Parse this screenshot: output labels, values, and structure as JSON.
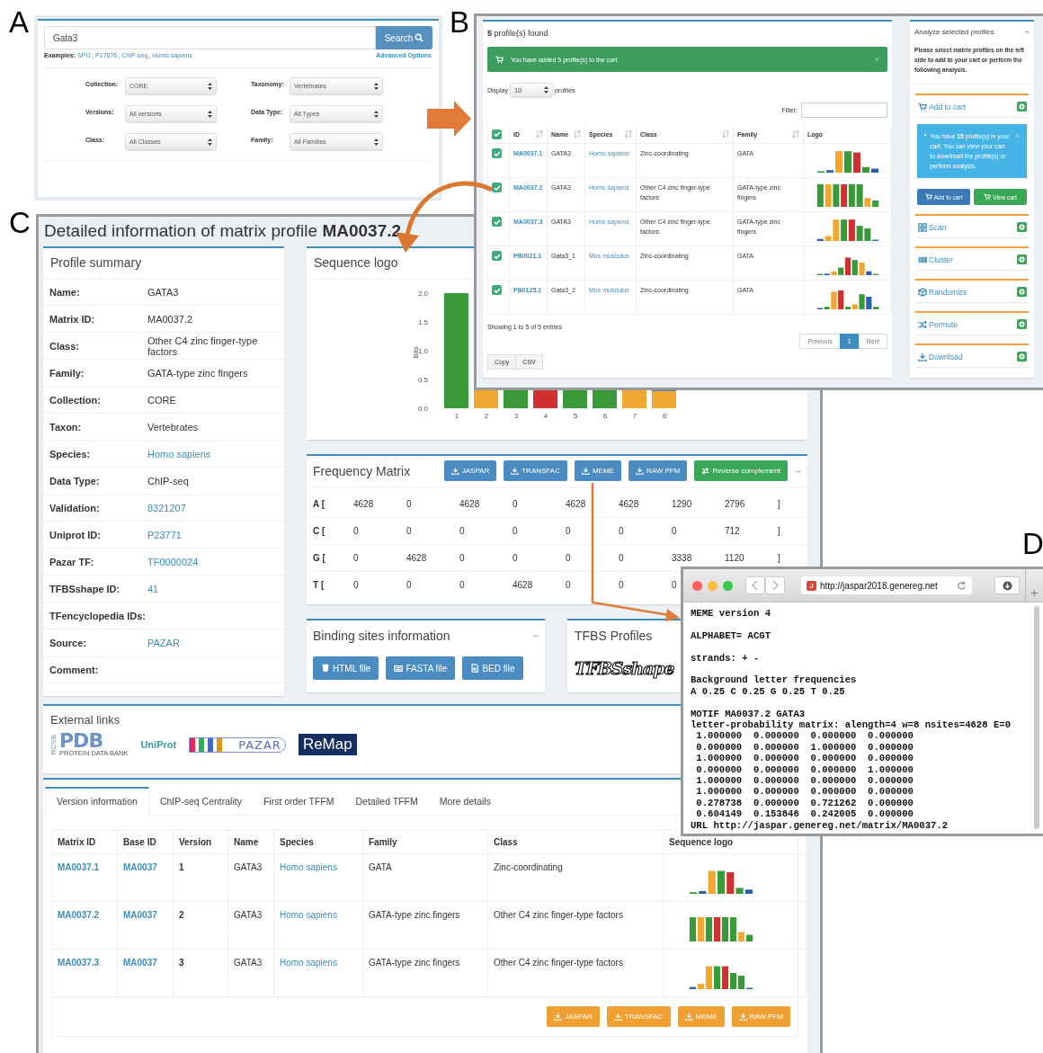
{
  "figure_labels": [
    "A",
    "B",
    "C",
    "D"
  ],
  "panel_a": {
    "search": {
      "value": "Gata3",
      "button": "Search"
    },
    "examples_label": "Examples:",
    "examples": [
      {
        "text": "SPI1",
        "sep": ","
      },
      {
        "text": "P17676",
        "sep": ","
      },
      {
        "text": "ChIP-seq",
        "sep": ","
      },
      {
        "text": "Homo sapiens"
      }
    ],
    "advanced": "Advanced Options",
    "filters": [
      {
        "label": "Collection:",
        "value": "CORE"
      },
      {
        "label": "Taxonomy:",
        "value": "Vertebrates"
      },
      {
        "label": "Versions:",
        "value": "All versions"
      },
      {
        "label": "Data Type:",
        "value": "All Types"
      },
      {
        "label": "Class:",
        "value": "All Classes"
      },
      {
        "label": "Family:",
        "value": "All Families"
      }
    ]
  },
  "panel_b": {
    "results": {
      "title": "**5** profile(s) found",
      "alert": "You have added 5 profile(s) to the cart.",
      "alert_close": "×",
      "display_label": "Display",
      "display_value": "10",
      "display_suffix": "profiles",
      "filter_label": "Filter:",
      "all_checked": true,
      "columns": [
        "ID",
        "Name",
        "Species",
        "Class",
        "Family",
        "Logo"
      ],
      "rows": [
        {
          "checked": true,
          "id": "MA0037.1",
          "name": "GATA3",
          "species": "Homo sapiens",
          "class": "Zinc-coordinating",
          "family": "GATA"
        },
        {
          "checked": true,
          "id": "MA0037.2",
          "name": "GATA3",
          "species": "Homo sapiens",
          "class": "Other C4 zinc finger-type factors",
          "family": "GATA-type zinc fingers"
        },
        {
          "checked": true,
          "id": "MA0037.3",
          "name": "GATA3",
          "species": "Homo sapiens",
          "class": "Other C4 zinc finger-type factors",
          "family": "GATA-type zinc fingers"
        },
        {
          "checked": true,
          "id": "PB0021.1",
          "name": "Gata3_1",
          "species": "Mus musculus",
          "class": "Zinc-coordinating",
          "family": "GATA"
        },
        {
          "checked": true,
          "id": "PB0125.1",
          "name": "Gata3_2",
          "species": "Mus musculus",
          "class": "Zinc-coordinating",
          "family": "GATA"
        }
      ],
      "info": "Showing 1 to 5 of 5 entries",
      "pages": [
        {
          "label": "Previous",
          "selected": false
        },
        {
          "label": "1",
          "selected": true
        },
        {
          "label": "Next",
          "selected": false
        }
      ],
      "export_buttons": [
        "Copy",
        "CSV"
      ]
    },
    "analyze": {
      "title": "Analyze selected profiles",
      "collapse": "−",
      "note": "Please select matrix profiles on the left side to add to your cart or perform the following analysis.",
      "cart_info": "You have **15** profile(s) in your cart. You can view your cart to download the profile(s) or perform analysis.",
      "info_close": "×",
      "cart_buttons": [
        {
          "label": "Add to cart",
          "kind": "primary"
        },
        {
          "label": "View cart",
          "kind": "success"
        }
      ],
      "actions": [
        {
          "label": "Add to cart",
          "kind": "cart"
        },
        {
          "label": "Scan",
          "kind": "scan"
        },
        {
          "label": "Cluster",
          "kind": "cluster"
        },
        {
          "label": "Randomize",
          "kind": "randomize"
        },
        {
          "label": "Permute",
          "kind": "permute"
        },
        {
          "label": "Download",
          "kind": "download"
        }
      ]
    }
  },
  "panel_c": {
    "title": "Detailed information of matrix profile **MA0037.2**",
    "summary": {
      "title": "Profile summary",
      "rows": [
        {
          "label": "Name:",
          "value": "GATA3",
          "link": false
        },
        {
          "label": "Matrix ID:",
          "value": "MA0037.2",
          "link": false
        },
        {
          "label": "Class:",
          "value": "Other C4 zinc finger-type factors",
          "link": false
        },
        {
          "label": "Family:",
          "value": "GATA-type zinc fingers",
          "link": false
        },
        {
          "label": "Collection:",
          "value": "CORE",
          "link": false
        },
        {
          "label": "Taxon:",
          "value": "Vertebrates",
          "link": false
        },
        {
          "label": "Species:",
          "value": "Homo sapiens",
          "link": true
        },
        {
          "label": "Data Type:",
          "value": "ChIP-seq",
          "link": false
        },
        {
          "label": "Validation:",
          "value": "8321207",
          "link": true
        },
        {
          "label": "Uniprot ID:",
          "value": "P23771",
          "link": true
        },
        {
          "label": "Pazar TF:",
          "value": "TF0000024",
          "link": true
        },
        {
          "label": "TFBSshape ID:",
          "value": "41",
          "link": true
        },
        {
          "label": "TFencyclopedia IDs:"
        },
        {
          "label": "Source:",
          "value": "PAZAR",
          "link": true
        },
        {
          "label": "Comment:"
        }
      ]
    },
    "sequence_logo": {
      "title": "Sequence logo",
      "ylabel": "Bits",
      "yticks": [
        "2.0",
        "1.5",
        "1.0",
        "0.5",
        "0.0"
      ],
      "xticks": [
        "1",
        "2",
        "3",
        "4",
        "5",
        "6",
        "7",
        "8"
      ]
    },
    "frequency_matrix": {
      "title": "Frequency Matrix",
      "collapse": "−",
      "buttons": [
        {
          "label": "JASPAR",
          "kind": "download"
        },
        {
          "label": "TRANSFAC",
          "kind": "download"
        },
        {
          "label": "MEME",
          "kind": "download"
        },
        {
          "label": "RAW PFM",
          "kind": "download"
        },
        {
          "label": "Reverse complement",
          "kind": "reverse"
        }
      ],
      "rows": [
        {
          "base": "A [",
          "values": [
            "4628",
            "0",
            "4628",
            "0",
            "4628",
            "4628",
            "1290",
            "2796"
          ],
          "close": "]"
        },
        {
          "base": "C [",
          "values": [
            "0",
            "0",
            "0",
            "0",
            "0",
            "0",
            "0",
            "712"
          ],
          "close": "]"
        },
        {
          "base": "G [",
          "values": [
            "0",
            "4628",
            "0",
            "0",
            "0",
            "0",
            "3338",
            "1120"
          ],
          "close": "]"
        },
        {
          "base": "T [",
          "values": [
            "0",
            "0",
            "0",
            "4628",
            "0",
            "0",
            "0"
          ]
        }
      ]
    },
    "binding_sites": {
      "title": "Binding sites information",
      "collapse": "−",
      "buttons": [
        {
          "label": "HTML file",
          "kind": "html"
        },
        {
          "label": "FASTA file",
          "kind": "fasta"
        },
        {
          "label": "BED file",
          "kind": "bed"
        }
      ]
    },
    "tfbs_profiles": {
      "title": "TFBS Profiles",
      "logo": "TFBSshape"
    },
    "external_links": {
      "title": "External links",
      "logos": [
        {
          "kind": "pdb",
          "top": "RCSB",
          "text": "PDB",
          "subtitle": "PROTEIN DATA BANK"
        },
        {
          "kind": "uniprot",
          "text": "UniProt"
        },
        {
          "kind": "pazar",
          "text": "PAZAR"
        },
        {
          "kind": "remap",
          "text": "ReMap"
        }
      ]
    },
    "tabs": [
      {
        "label": "Version information",
        "selected": true
      },
      {
        "label": "ChIP-seq Centrality",
        "selected": false
      },
      {
        "label": "First order TFFM",
        "selected": false
      },
      {
        "label": "Detailed TFFM",
        "selected": false
      },
      {
        "label": "More details",
        "selected": false
      }
    ],
    "versions": {
      "columns": [
        "Matrix ID",
        "Base ID",
        "Version",
        "Name",
        "Species",
        "Family",
        "Class",
        "Sequence logo"
      ],
      "rows": [
        {
          "matrix_id": "MA0037.1",
          "base_id": "MA0037",
          "version": "1",
          "name": "GATA3",
          "species": "Homo sapiens",
          "family": "GATA",
          "class": "Zinc-coordinating"
        },
        {
          "matrix_id": "MA0037.2",
          "base_id": "MA0037",
          "version": "2",
          "name": "GATA3",
          "species": "Homo sapiens",
          "family": "GATA-type zinc fingers",
          "class": "Other C4 zinc finger-type factors"
        },
        {
          "matrix_id": "MA0037.3",
          "base_id": "MA0037",
          "version": "3",
          "name": "GATA3",
          "species": "Homo sapiens",
          "family": "GATA-type zinc fingers",
          "class": "Other C4 zinc finger-type factors"
        }
      ],
      "buttons": [
        "JASPAR",
        "TRANSFAC",
        "MEME",
        "RAW PFM"
      ]
    }
  },
  "panel_d": {
    "favicon": "J",
    "url": "http://jaspar2018.genereg.net",
    "new_tab": "+",
    "blocks": [
      [
        "MEME version 4"
      ],
      [
        "ALPHABET= ACGT"
      ],
      [
        "strands: + -"
      ],
      [
        "Background letter frequencies",
        "A 0.25 C 0.25 G 0.25 T 0.25"
      ],
      [
        "MOTIF MA0037.2 GATA3",
        "letter-probability matrix: alength=4 w=8 nsites=4628 E=0",
        " 1.000000  0.000000  0.000000  0.000000",
        " 0.000000  0.000000  1.000000  0.000000",
        " 1.000000  0.000000  0.000000  0.000000",
        " 0.000000  0.000000  0.000000  1.000000",
        " 1.000000  0.000000  0.000000  0.000000",
        " 1.000000  0.000000  0.000000  0.000000",
        " 0.278738  0.000000  0.721262  0.000000",
        " 0.604149  0.153846  0.242005  0.000000",
        "URL http://jaspar.genereg.net/matrix/MA0037.2"
      ]
    ]
  }
}
